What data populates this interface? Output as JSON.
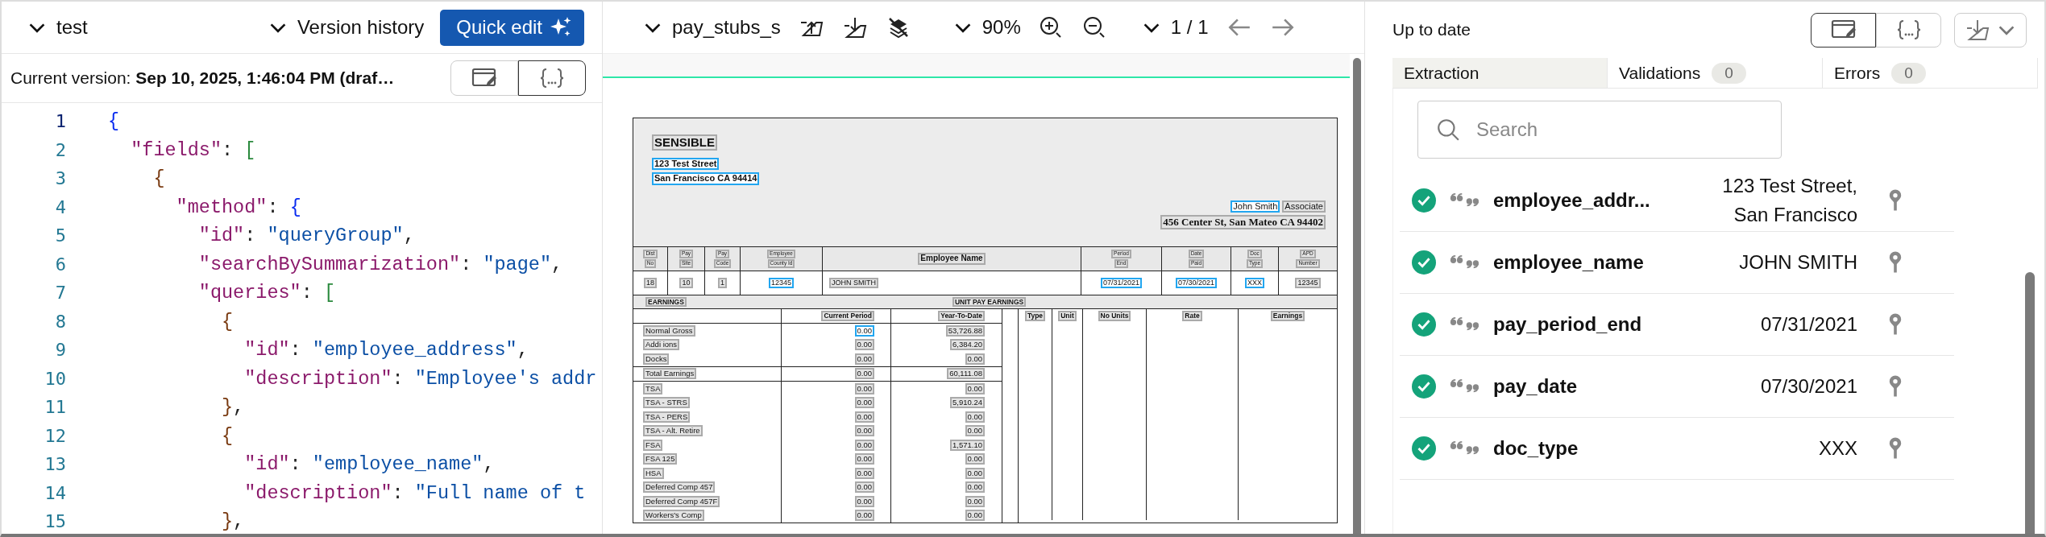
{
  "editor": {
    "project": "test",
    "version_history": "Version history",
    "quick_edit": "Quick edit",
    "current_version": "Current version: **Sep 10, 2025, 1:46:04 PM (draf…**",
    "view_toggle": [
      {
        "kind": "edit",
        "selected": false
      },
      {
        "kind": "braces",
        "selected": true
      }
    ],
    "lines": [
      {
        "number": "1",
        "tokens": [
          {
            "text": "{",
            "kind": "b1"
          }
        ]
      },
      {
        "number": "2",
        "tokens": [
          {
            "text": "\"fields\"",
            "kind": "key"
          },
          {
            "text": ":",
            "kind": "p"
          },
          {
            "text": "[",
            "kind": "b2"
          }
        ]
      },
      {
        "number": "3",
        "tokens": [
          {
            "text": "{",
            "kind": "b3"
          }
        ]
      },
      {
        "number": "4",
        "tokens": [
          {
            "text": "\"method\"",
            "kind": "key"
          },
          {
            "text": ":",
            "kind": "p"
          },
          {
            "text": "{",
            "kind": "b1"
          }
        ]
      },
      {
        "number": "5",
        "tokens": [
          {
            "text": "\"id\"",
            "kind": "key"
          },
          {
            "text": ":",
            "kind": "p"
          },
          {
            "text": "\"queryGroup\"",
            "kind": "str"
          },
          {
            "text": ",",
            "kind": "p"
          }
        ]
      },
      {
        "number": "6",
        "tokens": [
          {
            "text": "\"searchBySummarization\"",
            "kind": "key"
          },
          {
            "text": ":",
            "kind": "p"
          },
          {
            "text": "\"page\"",
            "kind": "str"
          },
          {
            "text": ",",
            "kind": "p"
          }
        ]
      },
      {
        "number": "7",
        "tokens": [
          {
            "text": "\"queries\"",
            "kind": "key"
          },
          {
            "text": ":",
            "kind": "p"
          },
          {
            "text": "[",
            "kind": "b2"
          }
        ]
      },
      {
        "number": "8",
        "tokens": [
          {
            "text": "{",
            "kind": "b3"
          }
        ]
      },
      {
        "number": "9",
        "tokens": [
          {
            "text": "\"id\"",
            "kind": "key"
          },
          {
            "text": ":",
            "kind": "p"
          },
          {
            "text": "\"employee_address\"",
            "kind": "str"
          },
          {
            "text": ",",
            "kind": "p"
          }
        ]
      },
      {
        "number": "10",
        "tokens": [
          {
            "text": "\"description\"",
            "kind": "key"
          },
          {
            "text": ":",
            "kind": "p"
          },
          {
            "text": "\"Employee's addr",
            "kind": "str"
          }
        ]
      },
      {
        "number": "11",
        "tokens": [
          {
            "text": "}",
            "kind": "b3"
          },
          {
            "text": ",",
            "kind": "p"
          }
        ]
      },
      {
        "number": "12",
        "tokens": [
          {
            "text": "{",
            "kind": "b3"
          }
        ]
      },
      {
        "number": "13",
        "tokens": [
          {
            "text": "\"id\"",
            "kind": "key"
          },
          {
            "text": ":",
            "kind": "p"
          },
          {
            "text": "\"employee_name\"",
            "kind": "str"
          },
          {
            "text": ",",
            "kind": "p"
          }
        ]
      },
      {
        "number": "14",
        "tokens": [
          {
            "text": "\"description\"",
            "kind": "key"
          },
          {
            "text": ":",
            "kind": "p"
          },
          {
            "text": "\"Full name of t",
            "kind": "str"
          }
        ]
      },
      {
        "number": "15",
        "tokens": [
          {
            "text": "}",
            "kind": "b3"
          },
          {
            "text": ",",
            "kind": "p"
          }
        ]
      }
    ]
  },
  "viewer": {
    "file_name": "pay_stubs_s",
    "zoom": "90%",
    "page": "1 / 1",
    "document": {
      "company": "SENSIBLE",
      "company_address": [
        {
          "text": "123 Test Street",
          "highlighted": true
        },
        {
          "text": "San Francisco CA 94414",
          "highlighted": true
        }
      ],
      "employee": [
        {
          "text": "John Smith",
          "highlighted": true
        },
        {
          "text": "Associate",
          "highlighted": false
        }
      ],
      "employee_address": "456 Center St, San Mateo CA 94402",
      "columns": [
        {
          "label": [
            "Dist",
            "No"
          ],
          "value": "18",
          "highlighted": false
        },
        {
          "label": [
            "Pay",
            "Site"
          ],
          "value": "10",
          "highlighted": false
        },
        {
          "label": [
            "Pay",
            "Code"
          ],
          "value": "1",
          "highlighted": false
        },
        {
          "label": [
            "Employee",
            "County Id"
          ],
          "value": "12345",
          "highlighted": true
        },
        {
          "label": [
            "Employee Name"
          ],
          "value": "JOHN SMITH",
          "highlighted": false
        },
        {
          "label": [
            "Period",
            "End"
          ],
          "value": "07/31/2021",
          "highlighted": true
        },
        {
          "label": [
            "Date",
            "Paid"
          ],
          "value": "07/30/2021",
          "highlighted": true
        },
        {
          "label": [
            "Doc",
            "Type"
          ],
          "value": "XXX",
          "highlighted": true
        },
        {
          "label": [
            "APD",
            "Number"
          ],
          "value": "12345",
          "highlighted": false
        }
      ],
      "earnings_title": "EARNINGS",
      "unit_title": "UNIT PAY EARNINGS",
      "earnings_headers": [
        "Current Period",
        "Year-To-Date"
      ],
      "unit_headers": [
        "Type",
        "Unit",
        "No Units",
        "Rate",
        "Earnings"
      ],
      "rows": [
        {
          "label": "Normal Gross",
          "current": "0.00",
          "ytd": "53,726.88",
          "highlighted": true
        },
        {
          "label": "Addi ions",
          "current": "0.00",
          "ytd": "6,384.20",
          "highlighted": false
        },
        {
          "label": "Docks",
          "current": "0.00",
          "ytd": "0.00",
          "highlighted": false
        },
        {
          "label": "Total Earnings",
          "current": "0.00",
          "ytd": "60,111.08",
          "highlighted": false
        },
        {
          "label": "TSA",
          "current": "0.00",
          "ytd": "0.00",
          "highlighted": false
        },
        {
          "label": "TSA - STRS",
          "current": "0.00",
          "ytd": "5,910.24",
          "highlighted": false
        },
        {
          "label": "TSA - PERS",
          "current": "0.00",
          "ytd": "0.00",
          "highlighted": false
        },
        {
          "label": "TSA - Alt. Retire",
          "current": "0.00",
          "ytd": "0.00",
          "highlighted": false
        },
        {
          "label": "FSA",
          "current": "0.00",
          "ytd": "1,571.10",
          "highlighted": false
        },
        {
          "label": "FSA 125",
          "current": "0.00",
          "ytd": "0.00",
          "highlighted": false
        },
        {
          "label": "HSA",
          "current": "0.00",
          "ytd": "0.00",
          "highlighted": false
        },
        {
          "label": "Deferred Comp 457",
          "current": "0.00",
          "ytd": "0.00",
          "highlighted": false
        },
        {
          "label": "Deferred Comp 457F",
          "current": "0.00",
          "ytd": "0.00",
          "highlighted": false
        },
        {
          "label": "Workers's Comp",
          "current": "0.00",
          "ytd": "0.00",
          "highlighted": false
        }
      ]
    }
  },
  "results": {
    "status": "Up to date",
    "view_toggle": [
      {
        "kind": "edit",
        "selected": true
      },
      {
        "kind": "braces",
        "selected": false
      }
    ],
    "tabs": [
      {
        "label": "Extraction",
        "selected": true
      },
      {
        "label": "Validations",
        "count": "0",
        "selected": false
      },
      {
        "label": "Errors",
        "count": "0",
        "selected": false
      }
    ],
    "search": {
      "placeholder": "Search"
    },
    "fields": [
      {
        "name": "employee_addr...",
        "value": "123 Test Street, San Francisco",
        "kind": "valid"
      },
      {
        "name": "employee_name",
        "value": "JOHN SMITH",
        "kind": "valid"
      },
      {
        "name": "pay_period_end",
        "value": "07/31/2021",
        "kind": "valid"
      },
      {
        "name": "pay_date",
        "value": "07/30/2021",
        "kind": "valid"
      },
      {
        "name": "doc_type",
        "value": "XXX",
        "kind": "valid"
      }
    ]
  }
}
